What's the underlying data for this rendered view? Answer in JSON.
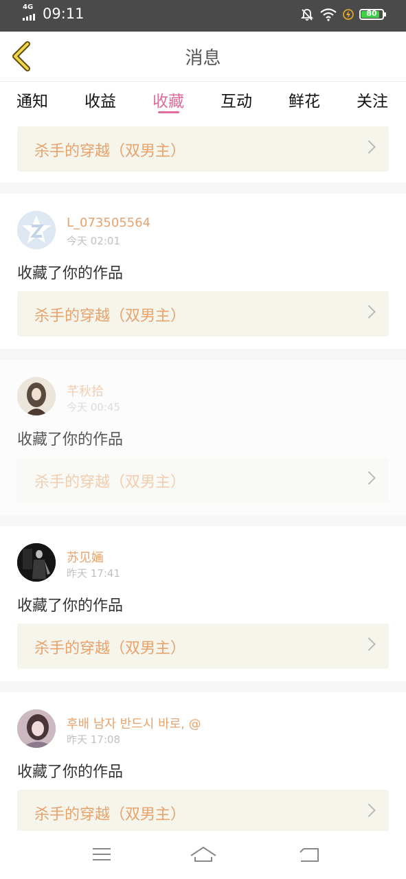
{
  "status_bar": {
    "network": "4G",
    "time": "09:11",
    "battery": "80"
  },
  "header": {
    "title": "消息"
  },
  "tabs": [
    {
      "label": "通知"
    },
    {
      "label": "收益"
    },
    {
      "label": "收藏",
      "active": true
    },
    {
      "label": "互动"
    },
    {
      "label": "鲜花"
    },
    {
      "label": "关注"
    }
  ],
  "top_work": {
    "title": "杀手的穿越（双男主）"
  },
  "messages": [
    {
      "username": "L_073505564",
      "time": "今天 02:01",
      "action": "收藏了你的作品",
      "work_title": "杀手的穿越（双男主）"
    },
    {
      "username": "芊秋拾",
      "time": "今天 00:45",
      "action": "收藏了你的作品",
      "work_title": "杀手的穿越（双男主）"
    },
    {
      "username": "苏见婳",
      "time": "昨天 17:41",
      "action": "收藏了你的作品",
      "work_title": "杀手的穿越（双男主）"
    },
    {
      "username": "후배 남자 반드시 바로, @",
      "time": "昨天 17:08",
      "action": "收藏了你的作品",
      "work_title": "杀手的穿越（双男主）"
    }
  ],
  "colors": {
    "accent": "#e06a9a",
    "name": "#e8a26c",
    "work_bg": "#f6f5ec"
  }
}
